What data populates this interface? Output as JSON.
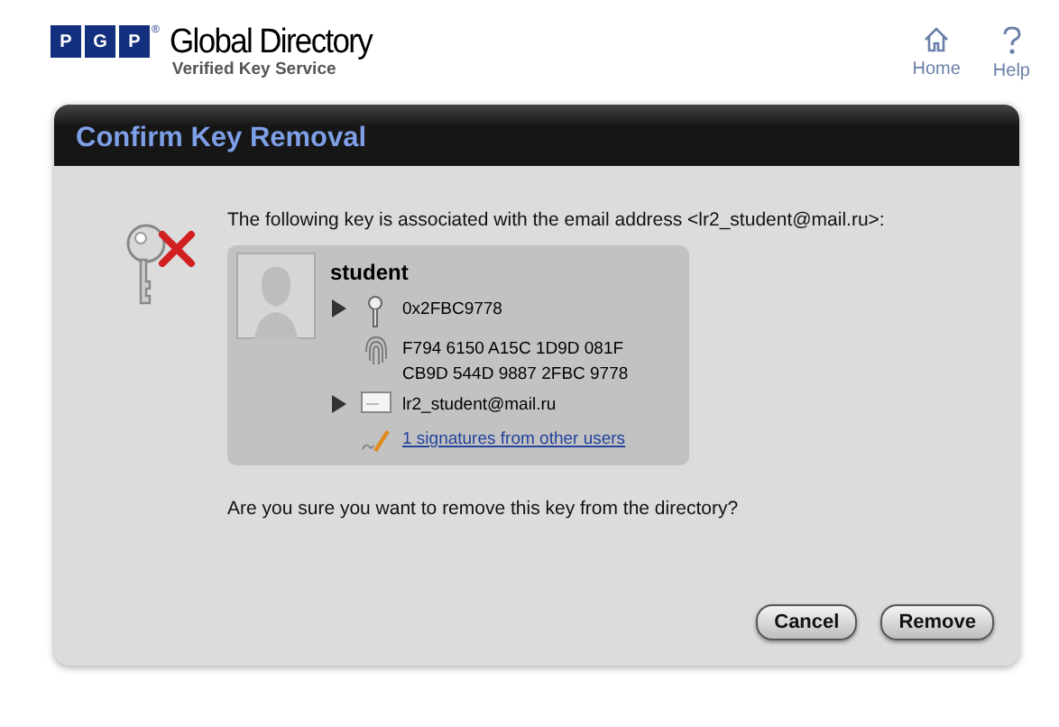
{
  "logo": {
    "letters": [
      "P",
      "G",
      "P"
    ],
    "mark": "®",
    "title": "Global Directory",
    "subtitle": "Verified Key Service"
  },
  "nav": [
    {
      "kind": "home",
      "label": "Home"
    },
    {
      "kind": "help",
      "label": "Help"
    }
  ],
  "dialog": {
    "title": "Confirm Key Removal",
    "intro": "The following key is associated with the email address <lr2_student@mail.ru>:",
    "key_card": {
      "name": "student",
      "rows": [
        {
          "kind": "key-id",
          "texts": [
            "0x2FBC9778"
          ],
          "expanded": false
        },
        {
          "kind": "fingerprint",
          "texts": [
            "F794 6150 A15C 1D9D 081F",
            "CB9D 544D 9887 2FBC 9778"
          ]
        },
        {
          "kind": "email",
          "texts": [
            "lr2_student@mail.ru"
          ],
          "expanded": false
        },
        {
          "kind": "signatures",
          "texts": [
            "1 signatures from other users"
          ]
        }
      ]
    },
    "question": "Are you sure you want to remove this key from the directory?",
    "buttons": [
      "Cancel",
      "Remove"
    ]
  }
}
